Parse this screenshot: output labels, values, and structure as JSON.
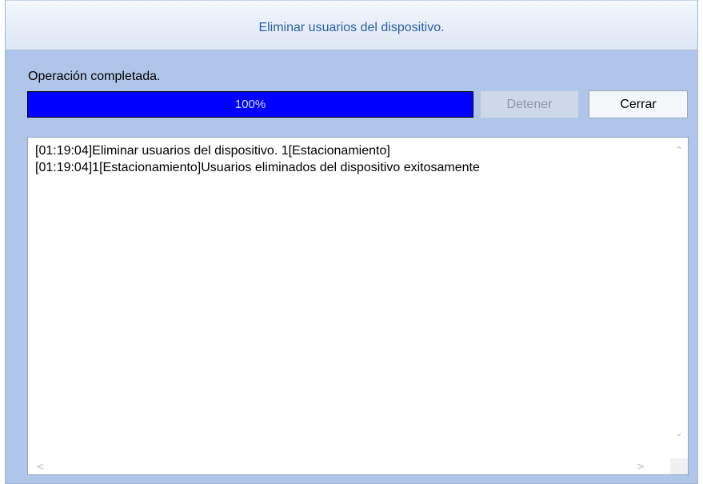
{
  "window": {
    "title": "Eliminar usuarios del dispositivo."
  },
  "status": {
    "text": "Operación completada."
  },
  "progress": {
    "value": 100,
    "label": "100%",
    "fill_color": "#0000ff"
  },
  "buttons": {
    "stop_label": "Detener",
    "close_label": "Cerrar"
  },
  "log": {
    "lines": [
      "[01:19:04]Eliminar usuarios del dispositivo. 1[Estacionamiento]",
      "[01:19:04]1[Estacionamiento]Usuarios eliminados del dispositivo exitosamente"
    ]
  },
  "icons": {
    "up": "chevron-up-icon",
    "down": "chevron-down-icon",
    "left": "chevron-left-icon",
    "right": "chevron-right-icon"
  }
}
